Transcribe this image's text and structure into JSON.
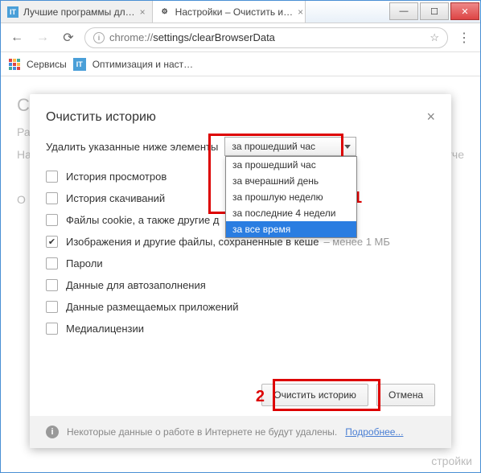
{
  "tabs": [
    {
      "favicon": "IT",
      "label": "Лучшие программы дл…"
    },
    {
      "favicon": "gear",
      "label": "Настройки – Очистить и…"
    }
  ],
  "address": {
    "info": "i",
    "prefix": "chrome://",
    "path": "settings/clearBrowserData"
  },
  "bookmarks": {
    "apps": "Сервисы",
    "item1": "Оптимизация и наст…"
  },
  "bg": {
    "title": "Ch",
    "row1": "Ра",
    "row2": "На",
    "row3": "О",
    "tail1": "и отче",
    "tail2": "стройки"
  },
  "dialog": {
    "title": "Очистить историю",
    "prompt": "Удалить указанные ниже элементы",
    "select_value": "за прошедший час",
    "options": [
      "за прошедший час",
      "за вчерашний день",
      "за прошлую неделю",
      "за последние 4 недели",
      "за все время"
    ],
    "selected_index": 4,
    "checks": [
      {
        "label": "История просмотров",
        "checked": false
      },
      {
        "label": "История скачиваний",
        "checked": false
      },
      {
        "label": "Файлы cookie, а также другие д",
        "checked": false
      },
      {
        "label": "Изображения и другие файлы, сохраненные в кеше",
        "checked": true,
        "suffix": "– менее 1 МБ"
      },
      {
        "label": "Пароли",
        "checked": false
      },
      {
        "label": "Данные для автозаполнения",
        "checked": false
      },
      {
        "label": "Данные размещаемых приложений",
        "checked": false
      },
      {
        "label": "Медиалицензии",
        "checked": false
      }
    ],
    "ok": "Очистить историю",
    "cancel": "Отмена",
    "info": "Некоторые данные о работе в Интернете не будут удалены.",
    "info_link": "Подробнее..."
  },
  "annot": {
    "n1": "1",
    "n2": "2"
  }
}
